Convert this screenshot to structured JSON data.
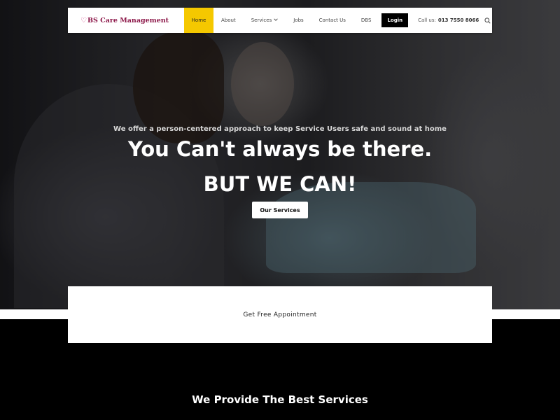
{
  "logo": {
    "text": "BS Care Management",
    "heart": "♡"
  },
  "nav": {
    "items": [
      {
        "label": "Home",
        "active": true
      },
      {
        "label": "About"
      },
      {
        "label": "Services",
        "has_dropdown": true
      },
      {
        "label": "Jobs"
      },
      {
        "label": "Contact Us"
      },
      {
        "label": "DBS"
      }
    ],
    "login_label": "Login",
    "phone_label": "Call us:",
    "phone_number": "013 7550 8066",
    "search_icon": "search-icon"
  },
  "hero": {
    "tagline": "We offer a person-centered approach to keep Service Users safe and sound at home",
    "headline": "You Can't always be there.",
    "headline2": "BUT WE CAN!",
    "cta_label": "Our Services"
  },
  "appointment": {
    "label": "Get Free Appointment"
  },
  "services": {
    "title": "We Provide The Best Services"
  },
  "colors": {
    "accent": "#f5c800",
    "logo": "#8b1547",
    "dark": "#000000"
  }
}
